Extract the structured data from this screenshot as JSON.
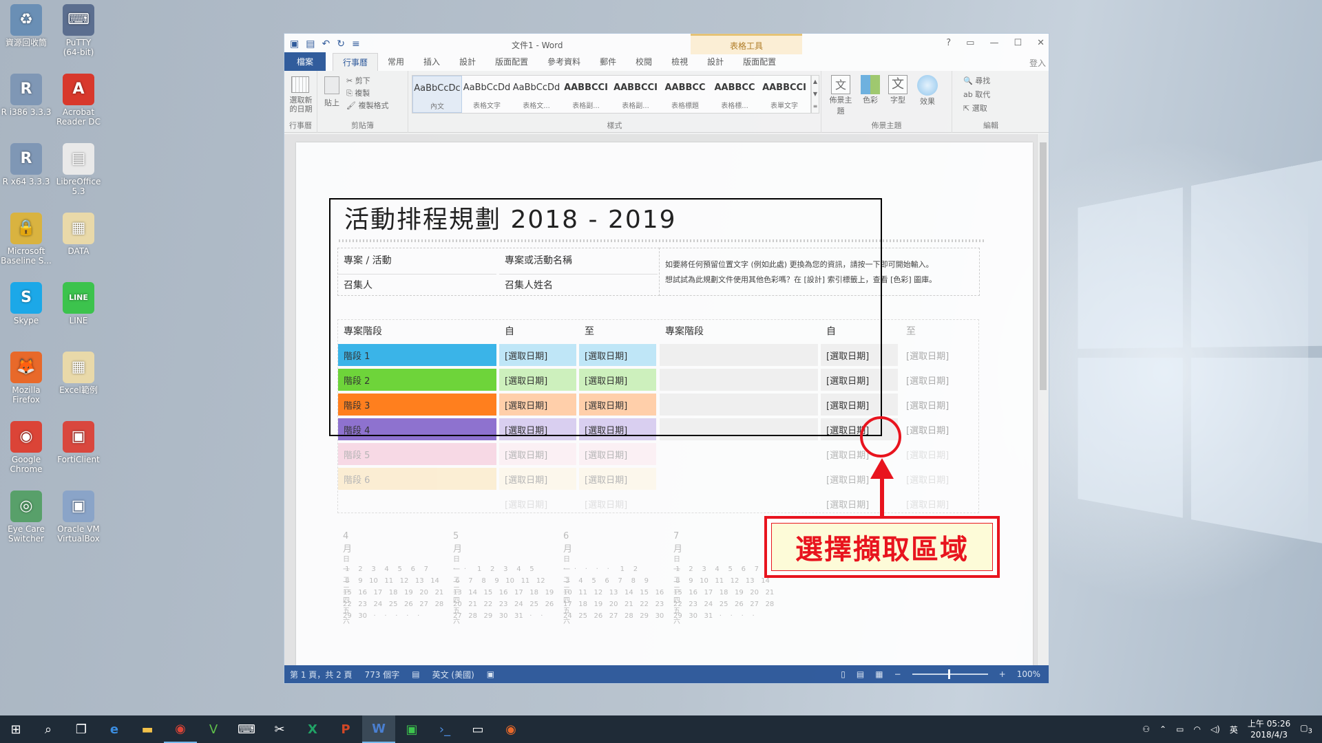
{
  "desktop": {
    "icons": [
      {
        "label": "資源回收筒",
        "glyph": "♻",
        "color": "#6a8fb5"
      },
      {
        "label": "PuTTY\n(64-bit)",
        "glyph": "⌨",
        "color": "#5b6e8f"
      },
      {
        "label": "R i386 3.3.3",
        "glyph": "R",
        "color": "#7f97b5"
      },
      {
        "label": "Acrobat\nReader DC",
        "glyph": "A",
        "color": "#d8382c"
      },
      {
        "label": "R x64 3.3.3",
        "glyph": "R",
        "color": "#7f97b5"
      },
      {
        "label": "LibreOffice\n5.3",
        "glyph": "▤",
        "color": "#e9e9e9"
      },
      {
        "label": "Microsoft\nBaseline S...",
        "glyph": "🔒",
        "color": "#d9b340"
      },
      {
        "label": "DATA",
        "glyph": "▦",
        "color": "#e9d9a9"
      },
      {
        "label": "Skype",
        "glyph": "S",
        "color": "#1ca8e8"
      },
      {
        "label": "LINE",
        "glyph": "LINE",
        "color": "#3cc34d"
      },
      {
        "label": "Mozilla\nFirefox",
        "glyph": "🦊",
        "color": "#e8692a"
      },
      {
        "label": "Excel範例",
        "glyph": "▦",
        "color": "#e9d9a9"
      },
      {
        "label": "Google\nChrome",
        "glyph": "◉",
        "color": "#db4437"
      },
      {
        "label": "FortiClient",
        "glyph": "▣",
        "color": "#d9473e"
      },
      {
        "label": "Eye Care\nSwitcher",
        "glyph": "◎",
        "color": "#58a06a"
      },
      {
        "label": "Oracle VM\nVirtualBox",
        "glyph": "▣",
        "color": "#8aa4c8"
      }
    ]
  },
  "word": {
    "doc_title": "文件1 - Word",
    "table_tools": "表格工具",
    "tabs": [
      "檔案",
      "行事曆",
      "常用",
      "插入",
      "設計",
      "版面配置",
      "參考資料",
      "郵件",
      "校閱",
      "檢視",
      "設計",
      "版面配置"
    ],
    "signin": "登入",
    "ribbon": {
      "calendar_btn": "選取新\n的日期",
      "group_calendar": "行事曆",
      "paste": "貼上",
      "cut": "剪下",
      "copy": "複製",
      "format_painter": "複製格式",
      "group_clipboard": "剪貼簿",
      "styles": [
        {
          "sample": "AaBbCcDc",
          "name": "內文"
        },
        {
          "sample": "AaBbCcDd",
          "name": "表格文字"
        },
        {
          "sample": "AaBbCcDd",
          "name": "表格文..."
        },
        {
          "sample": "AABBCCI",
          "name": "表格副..."
        },
        {
          "sample": "AABBCCI",
          "name": "表格副..."
        },
        {
          "sample": "AABBCC",
          "name": "表格標題"
        },
        {
          "sample": "AABBCC",
          "name": "表格標..."
        },
        {
          "sample": "AABBCCI",
          "name": "表單文字"
        }
      ],
      "group_styles": "樣式",
      "theme": "佈景主題",
      "colors": "色彩",
      "fonts": "字型",
      "effects": "效果",
      "group_theme": "佈景主題",
      "find": "尋找",
      "replace": "取代",
      "select": "選取",
      "group_edit": "編輯"
    },
    "status": {
      "page": "第 1 頁，共 2 頁",
      "words": "773 個字",
      "lang": "英文 (美國)",
      "zoom": "100%"
    }
  },
  "document": {
    "title": "活動排程規劃 2018 - 2019",
    "project_label": "專案 / 活動",
    "project_value": "專案或活動名稱",
    "owner_label": "召集人",
    "owner_value": "召集人姓名",
    "tip_line1": "如要將任何預留位置文字 (例如此處) 更換為您的資訊，請按一下即可開始輸入。",
    "tip_line2": "想試試為此規劃文件使用其他色彩嗎？在 [設計] 索引標籤上，查看 [色彩] 圖庫。",
    "col_stage": "專案階段",
    "col_from": "自",
    "col_to": "至",
    "pick_date": "[選取日期]",
    "stages": [
      {
        "label": "階段 1",
        "color": "#3ab4e8",
        "light": "#bfe6f7"
      },
      {
        "label": "階段 2",
        "color": "#6ed43a",
        "light": "#cdf0bd"
      },
      {
        "label": "階段 3",
        "color": "#ff7f1e",
        "light": "#ffcfaa"
      },
      {
        "label": "階段 4",
        "color": "#8e72cf",
        "light": "#d9cff0"
      },
      {
        "label": "階段 5",
        "color": "#f29bbb",
        "light": "#fbdde8"
      },
      {
        "label": "階段 6",
        "color": "#fdd68a",
        "light": "#fff0d0"
      }
    ],
    "months": [
      "4 月",
      "5 月",
      "6 月",
      "7 月"
    ],
    "weekday_header": "日 一 二 三 四 五 六"
  },
  "annotation": {
    "callout": "選擇擷取區域",
    "accent": "#e8141e"
  },
  "taskbar": {
    "time": "上午 05:26",
    "date": "2018/4/3",
    "ime": "英",
    "notify_count": "3"
  }
}
